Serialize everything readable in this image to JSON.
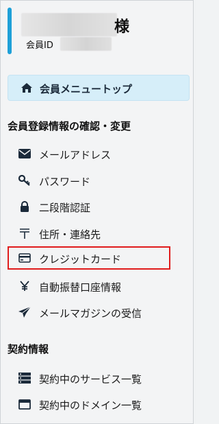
{
  "user": {
    "honorific": "様",
    "id_label": "会員ID"
  },
  "top_menu": {
    "label": "会員メニュートップ",
    "icon": "home-icon"
  },
  "sections": {
    "registration": {
      "title": "会員登録情報の確認・変更",
      "items": [
        {
          "label": "メールアドレス",
          "icon": "envelope-icon"
        },
        {
          "label": "パスワード",
          "icon": "key-icon"
        },
        {
          "label": "二段階認証",
          "icon": "lock-icon"
        },
        {
          "label": "住所・連絡先",
          "icon": "postal-mark-icon"
        },
        {
          "label": "クレジットカード",
          "icon": "credit-card-icon",
          "highlighted": true
        },
        {
          "label": "自動振替口座情報",
          "icon": "yen-icon"
        },
        {
          "label": "メールマガジンの受信",
          "icon": "paper-plane-icon"
        }
      ]
    },
    "contract": {
      "title": "契約情報",
      "items": [
        {
          "label": "契約中のサービス一覧",
          "icon": "server-icon"
        },
        {
          "label": "契約中のドメイン一覧",
          "icon": "browser-window-icon"
        }
      ]
    }
  },
  "colors": {
    "accent_bar": "#1ea0d8",
    "top_menu_bg": "#d6eef9",
    "highlight_border": "#e01b1b"
  }
}
